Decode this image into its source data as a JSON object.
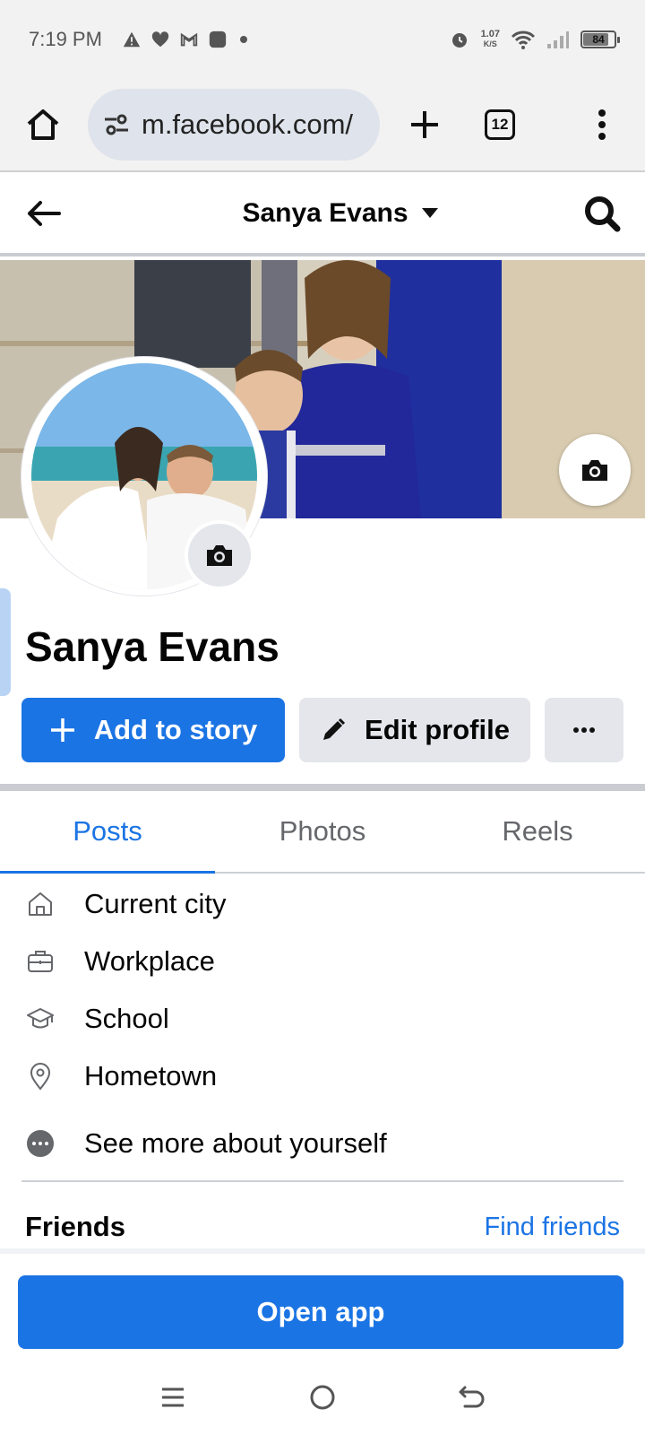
{
  "status_bar": {
    "time": "7:19 PM",
    "net_speed_value": "1.07",
    "net_speed_unit": "K/S",
    "battery": "84",
    "battery_level_percent": 84
  },
  "browser": {
    "url": "m.facebook.com/",
    "tab_count": "12"
  },
  "header": {
    "title": "Sanya Evans"
  },
  "profile": {
    "name": "Sanya Evans"
  },
  "actions": {
    "add_story": "Add to story",
    "edit_profile": "Edit profile"
  },
  "tabs": [
    {
      "label": "Posts",
      "active": true
    },
    {
      "label": "Photos",
      "active": false
    },
    {
      "label": "Reels",
      "active": false
    }
  ],
  "intro": [
    {
      "label": "Current city",
      "icon": "home-icon"
    },
    {
      "label": "Workplace",
      "icon": "briefcase-icon"
    },
    {
      "label": "School",
      "icon": "graduation-cap-icon"
    },
    {
      "label": "Hometown",
      "icon": "location-pin-icon"
    },
    {
      "label": "See more about yourself",
      "icon": "more-circle-icon"
    }
  ],
  "friends": {
    "title": "Friends",
    "link": "Find friends"
  },
  "open_app": {
    "label": "Open app"
  },
  "colors": {
    "brand_blue": "#1b74e4",
    "secondary_button": "#e4e6eb",
    "muted_text": "#65676b"
  }
}
